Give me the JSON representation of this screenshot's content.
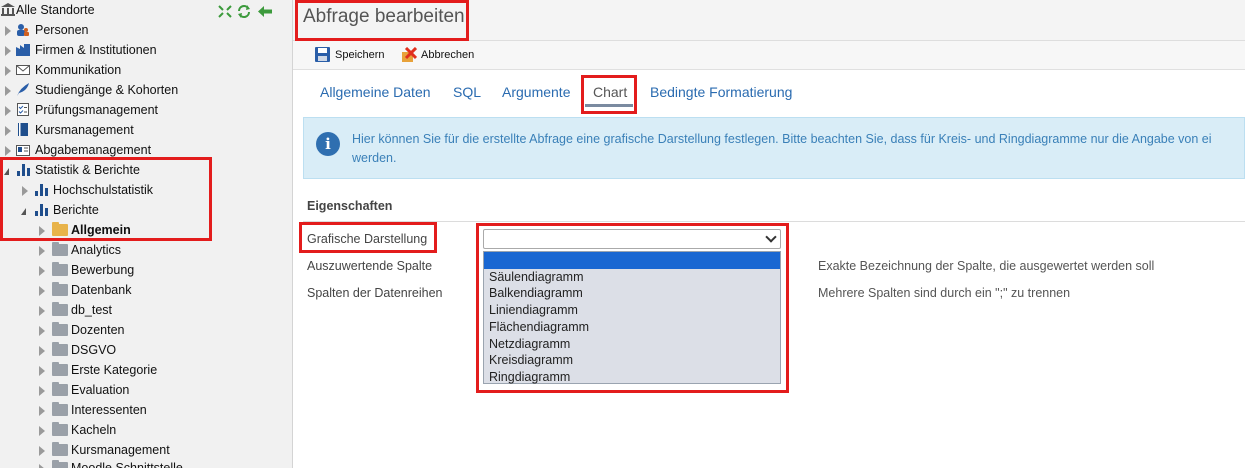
{
  "sidebar": {
    "root_label": "Alle Standorte",
    "items": [
      {
        "label": "Personen"
      },
      {
        "label": "Firmen & Institutionen"
      },
      {
        "label": "Kommunikation"
      },
      {
        "label": "Studiengänge & Kohorten"
      },
      {
        "label": "Prüfungsmanagement"
      },
      {
        "label": "Kursmanagement"
      },
      {
        "label": "Abgabemanagement"
      },
      {
        "label": "Statistik & Berichte"
      },
      {
        "label": "Hochschulstatistik"
      },
      {
        "label": "Berichte"
      },
      {
        "label": "Allgemein"
      },
      {
        "label": "Analytics"
      },
      {
        "label": "Bewerbung"
      },
      {
        "label": "Datenbank"
      },
      {
        "label": "db_test"
      },
      {
        "label": "Dozenten"
      },
      {
        "label": "DSGVO"
      },
      {
        "label": "Erste Kategorie"
      },
      {
        "label": "Evaluation"
      },
      {
        "label": "Interessenten"
      },
      {
        "label": "Kacheln"
      },
      {
        "label": "Kursmanagement"
      },
      {
        "label": "Moodle Schnittstelle"
      }
    ]
  },
  "header": {
    "title": "Abfrage bearbeiten"
  },
  "toolbar": {
    "save_label": "Speichern",
    "cancel_label": "Abbrechen"
  },
  "tabs": [
    {
      "label": "Allgemeine Daten"
    },
    {
      "label": "SQL"
    },
    {
      "label": "Argumente"
    },
    {
      "label": "Chart"
    },
    {
      "label": "Bedingte Formatierung"
    }
  ],
  "info": {
    "line1": "Hier können Sie für die erstellte Abfrage eine grafische Darstellung festlegen. Bitte beachten Sie, dass für Kreis- und Ringdiagramme nur die Angabe von ei",
    "line2": "werden."
  },
  "properties": {
    "heading": "Eigenschaften",
    "chart_type_label": "Grafische Darstellung",
    "column_label": "Auszuwertende Spalte",
    "column_hint": "Exakte Bezeichnung der Spalte, die ausgewertet werden soll",
    "series_label": "Spalten der Datenreihen",
    "series_hint": "Mehrere Spalten sind durch ein \";\" zu trennen",
    "chart_type_value": "",
    "options": [
      "",
      "Säulendiagramm",
      "Balkendiagramm",
      "Liniendiagramm",
      "Flächendiagramm",
      "Netzdiagramm",
      "Kreisdiagramm",
      "Ringdiagramm"
    ]
  },
  "colors": {
    "highlight": "#e31c1c",
    "link": "#2a6bb0",
    "selected_option": "#1967d2"
  }
}
